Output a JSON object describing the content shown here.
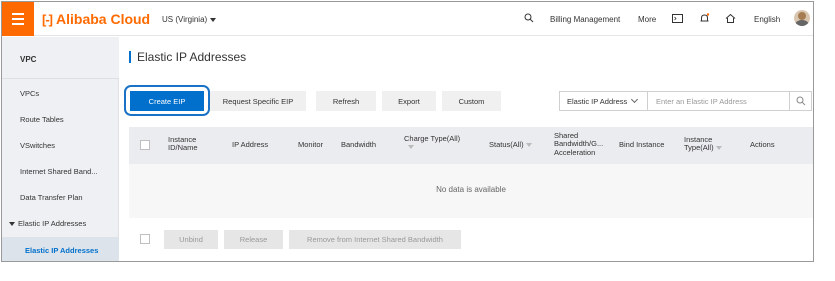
{
  "topbar": {
    "logo_text": "Alibaba Cloud",
    "logo_mark": "[-]",
    "region": "US (Virginia)",
    "billing": "Billing Management",
    "more": "More",
    "language": "English",
    "accent_color": "#ff6a00"
  },
  "sidebar": {
    "title": "VPC",
    "items": [
      "VPCs",
      "Route Tables",
      "VSwitches",
      "Internet Shared Band...",
      "Elastic IP Addresses"
    ],
    "group_label": "Elastic IP Addresses",
    "active_item": "Elastic IP Addresses"
  },
  "page": {
    "title": "Elastic IP Addresses"
  },
  "toolbar": {
    "create": "Create EIP",
    "request": "Request Specific EIP",
    "refresh": "Refresh",
    "export": "Export",
    "custom": "Custom",
    "filter_select": "Elastic IP Address",
    "search_placeholder": "Enter an Elastic IP Address"
  },
  "table": {
    "columns": {
      "instance_1": "Instance",
      "instance_2": "ID/Name",
      "ip": "IP Address",
      "monitor": "Monitor",
      "bandwidth": "Bandwidth",
      "charge": "Charge Type(All)",
      "status": "Status(All)",
      "shared_1": "Shared",
      "shared_2": "Bandwidth/G...",
      "shared_3": "Acceleration",
      "bind": "Bind Instance",
      "type_1": "Instance",
      "type_2": "Type(All)",
      "actions": "Actions"
    },
    "empty_text": "No data is available"
  },
  "bulk": {
    "unbind": "Unbind",
    "release": "Release",
    "remove": "Remove from Internet Shared Bandwidth"
  }
}
